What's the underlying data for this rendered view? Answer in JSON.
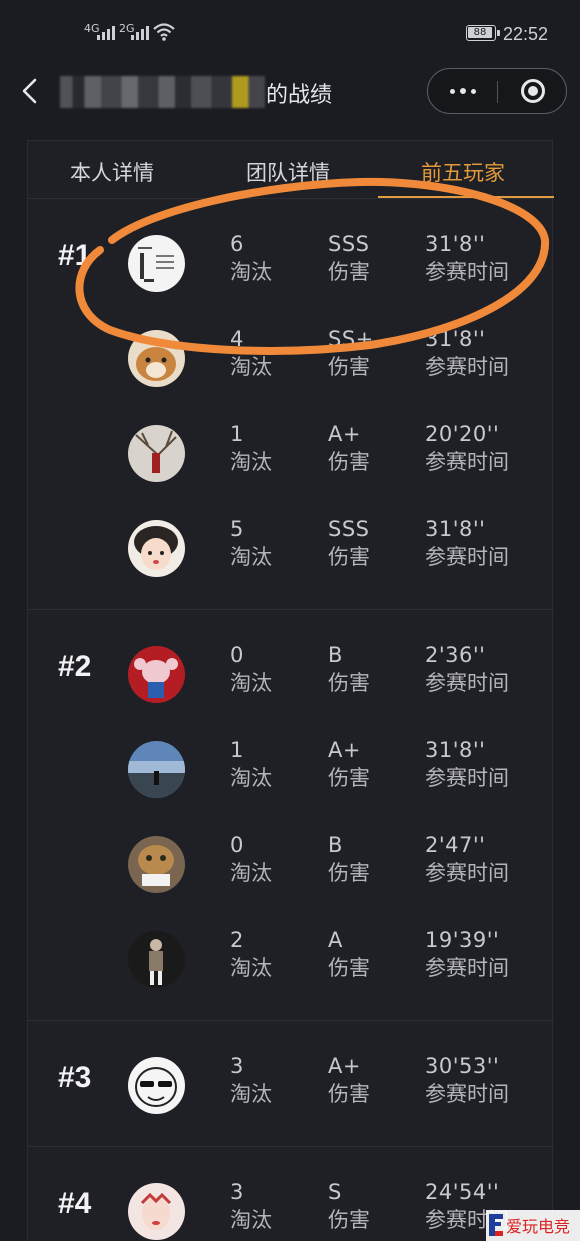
{
  "status_bar": {
    "signal1_label": "4G",
    "signal2_label": "2G",
    "battery": "88",
    "time": "22:52"
  },
  "nav": {
    "title_suffix": "的战绩"
  },
  "tabs": [
    "本人详情",
    "团队详情",
    "前五玩家"
  ],
  "active_tab": 2,
  "accent_color": "#e29a3c",
  "teams": [
    {
      "rank": "#1",
      "players": [
        {
          "kills": "6",
          "kills_label": "淘汰",
          "grade": "SSS",
          "grade_label": "伤害",
          "time": "31'8''",
          "time_label": "参赛时间"
        },
        {
          "kills": "4",
          "kills_label": "淘汰",
          "grade": "SS+",
          "grade_label": "伤害",
          "time": "31'8''",
          "time_label": "参赛时间"
        },
        {
          "kills": "1",
          "kills_label": "淘汰",
          "grade": "A+",
          "grade_label": "伤害",
          "time": "20'20''",
          "time_label": "参赛时间"
        },
        {
          "kills": "5",
          "kills_label": "淘汰",
          "grade": "SSS",
          "grade_label": "伤害",
          "time": "31'8''",
          "time_label": "参赛时间"
        }
      ]
    },
    {
      "rank": "#2",
      "players": [
        {
          "kills": "0",
          "kills_label": "淘汰",
          "grade": "B",
          "grade_label": "伤害",
          "time": "2'36''",
          "time_label": "参赛时间"
        },
        {
          "kills": "1",
          "kills_label": "淘汰",
          "grade": "A+",
          "grade_label": "伤害",
          "time": "31'8''",
          "time_label": "参赛时间"
        },
        {
          "kills": "0",
          "kills_label": "淘汰",
          "grade": "B",
          "grade_label": "伤害",
          "time": "2'47''",
          "time_label": "参赛时间"
        },
        {
          "kills": "2",
          "kills_label": "淘汰",
          "grade": "A",
          "grade_label": "伤害",
          "time": "19'39''",
          "time_label": "参赛时间"
        }
      ]
    },
    {
      "rank": "#3",
      "players": [
        {
          "kills": "3",
          "kills_label": "淘汰",
          "grade": "A+",
          "grade_label": "伤害",
          "time": "30'53''",
          "time_label": "参赛时间"
        }
      ]
    },
    {
      "rank": "#4",
      "players": [
        {
          "kills": "3",
          "kills_label": "淘汰",
          "grade": "S",
          "grade_label": "伤害",
          "time": "24'54''",
          "time_label": "参赛时间"
        }
      ]
    }
  ],
  "watermark": "爱玩电竞"
}
